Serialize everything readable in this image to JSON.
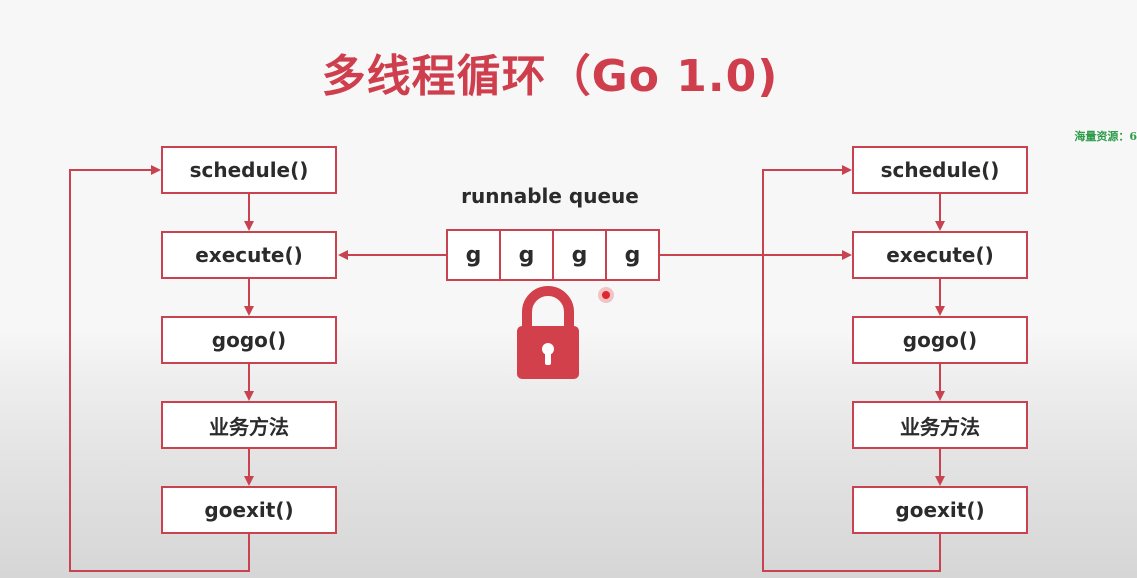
{
  "title": "多线程循环（Go 1.0)",
  "watermark": "海量资源：6",
  "queue": {
    "label": "runnable queue",
    "cells": [
      "g",
      "g",
      "g",
      "g"
    ]
  },
  "left_loop": {
    "steps": [
      "schedule()",
      "execute()",
      "gogo()",
      "业务方法",
      "goexit()"
    ]
  },
  "right_loop": {
    "steps": [
      "schedule()",
      "execute()",
      "gogo()",
      "业务方法",
      "goexit()"
    ]
  },
  "lock_icon": "padlock-icon",
  "colors": {
    "accent": "#c9424f",
    "title": "#cf3e4c",
    "lock": "#d2404b",
    "watermark": "#2e9d4b"
  }
}
